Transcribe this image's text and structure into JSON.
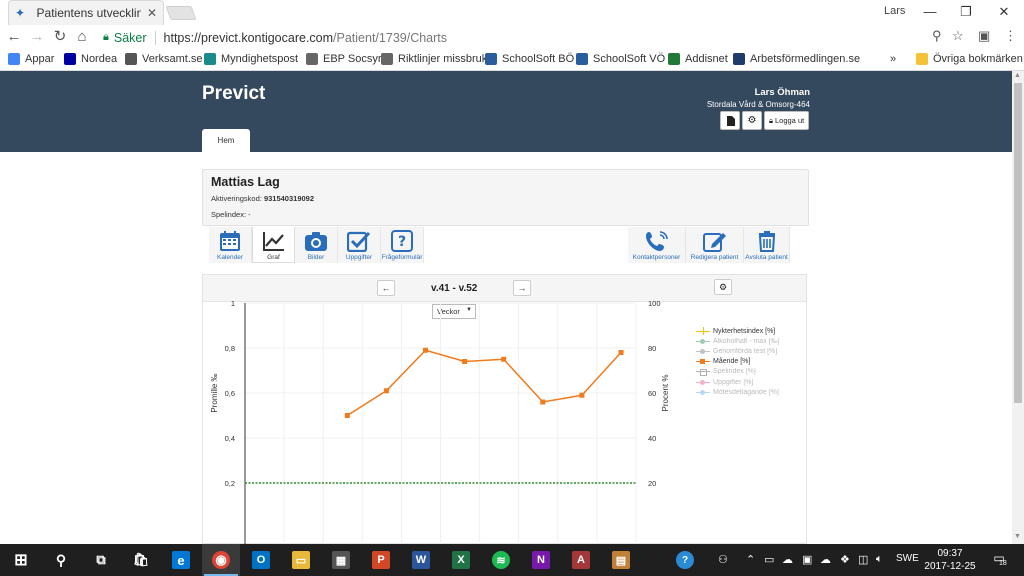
{
  "browser": {
    "tab_title": "Patientens utveckling - K",
    "win_user": "Lars",
    "secure_label": "Säker",
    "url_host": "https://previct.kontigocare.com",
    "url_path": "/Patient/1739/Charts"
  },
  "bookmarks": [
    {
      "label": "Appar",
      "icon": "apps-icon",
      "color": "#4285f4"
    },
    {
      "label": "Nordea",
      "icon": "nordea-icon",
      "color": "#0000a0"
    },
    {
      "label": "Verksamt.se",
      "icon": "verksamt-icon",
      "color": "#555555"
    },
    {
      "label": "Myndighetspost",
      "icon": "mail-icon",
      "color": "#1a8a8a"
    },
    {
      "label": "EBP Socsyr",
      "icon": "page-icon",
      "color": "#666666"
    },
    {
      "label": "Riktlinjer missbruk",
      "icon": "page-icon",
      "color": "#666666"
    },
    {
      "label": "SchoolSoft BÖ",
      "icon": "schoolsoft-icon",
      "color": "#2a5d9c"
    },
    {
      "label": "SchoolSoft VÖ",
      "icon": "schoolsoft-icon",
      "color": "#2a5d9c"
    },
    {
      "label": "Addisnet",
      "icon": "addisnet-icon",
      "color": "#1f7a3a"
    },
    {
      "label": "Arbetsförmedlingen.se",
      "icon": "af-icon",
      "color": "#1f3b6a"
    },
    {
      "label": "Övriga bokmärken",
      "icon": "folder-icon",
      "color": "#f3c237"
    }
  ],
  "app": {
    "brand": "Previct",
    "user_name": "Lars Öhman",
    "user_org": "Stordala Vård & Omsorg-464",
    "logout_label": "Logga ut",
    "home_tab": "Hem"
  },
  "patient": {
    "name": "Mattias Lag",
    "code_label": "Aktiveringskod:",
    "code_value": "931540319092",
    "index_label": "Spelindex: -"
  },
  "left_tools": [
    {
      "label": "Kalender",
      "icon": "calendar-icon",
      "active": false
    },
    {
      "label": "Graf",
      "icon": "chart-icon",
      "active": true
    },
    {
      "label": "Bilder",
      "icon": "camera-icon",
      "active": false
    },
    {
      "label": "Uppgifter",
      "icon": "checkbox-icon",
      "active": false
    },
    {
      "label": "Frågeformulär",
      "icon": "question-icon",
      "active": false
    }
  ],
  "right_tools": [
    {
      "label": "Kontaktpersoner",
      "icon": "phone-icon"
    },
    {
      "label": "Redigera patient",
      "icon": "edit-icon"
    },
    {
      "label": "Avsluta patient",
      "icon": "trash-icon"
    }
  ],
  "chart_controls": {
    "period": "v.41 - v.52",
    "view_select": "Veckor"
  },
  "chart_data": {
    "type": "line",
    "ylabel_left": "Promille ‰",
    "ylabel_right": "Procent %",
    "yleft_ticks": [
      "1",
      "0,8",
      "0,6",
      "0,4",
      "0,2"
    ],
    "yleft_values": [
      1,
      0.8,
      0.6,
      0.4,
      0.2
    ],
    "yleft_lim": [
      0,
      1
    ],
    "yright_ticks": [
      "100",
      "80",
      "60",
      "40",
      "20"
    ],
    "yright_values": [
      100,
      80,
      60,
      40,
      20
    ],
    "yright_lim": [
      0,
      100
    ],
    "x_count": 11,
    "grid": true,
    "threshold_line": {
      "y": 0.2,
      "color": "#2e8b2e"
    },
    "series": [
      {
        "name": "Mående [%]",
        "color": "#f07a1c",
        "x_index": [
          3,
          4,
          5,
          6,
          7,
          8,
          9,
          10
        ],
        "values": [
          50,
          61,
          79,
          74,
          75,
          56,
          59,
          78
        ]
      }
    ],
    "legend_position": "right",
    "legend": [
      {
        "label": "Nykterhetsindex [%]",
        "color": "#f5c400",
        "marker": "plus",
        "active": true
      },
      {
        "label": "Alkoholhalt - max [‰]",
        "color": "#2e8b57",
        "marker": "circle",
        "active": false
      },
      {
        "label": "Genomförda test [%]",
        "color": "#7a7a7a",
        "marker": "circle",
        "active": false
      },
      {
        "label": "Mående [%]",
        "color": "#f07a1c",
        "marker": "square",
        "active": true
      },
      {
        "label": "Spelindex [%]",
        "color": "#555555",
        "marker": "hollow",
        "active": false
      },
      {
        "label": "Uppgifter [%]",
        "color": "#e75480",
        "marker": "circle",
        "active": false
      },
      {
        "label": "Mötesdeltagande [%]",
        "color": "#5dade2",
        "marker": "circle",
        "active": false
      }
    ]
  },
  "taskbar": {
    "apps": [
      {
        "name": "start-icon"
      },
      {
        "name": "search-icon"
      },
      {
        "name": "task-view-icon"
      },
      {
        "name": "store-icon"
      },
      {
        "name": "edge-icon"
      },
      {
        "name": "chrome-icon"
      },
      {
        "name": "outlook-icon"
      },
      {
        "name": "explorer-icon"
      },
      {
        "name": "calculator-icon"
      },
      {
        "name": "powerpoint-icon"
      },
      {
        "name": "word-icon"
      },
      {
        "name": "excel-icon"
      },
      {
        "name": "spotify-icon"
      },
      {
        "name": "onenote-icon"
      },
      {
        "name": "access-icon"
      },
      {
        "name": "archive-icon"
      }
    ],
    "lang": "SWE",
    "time": "09:37",
    "date": "2017-12-25",
    "notifications": "18"
  }
}
